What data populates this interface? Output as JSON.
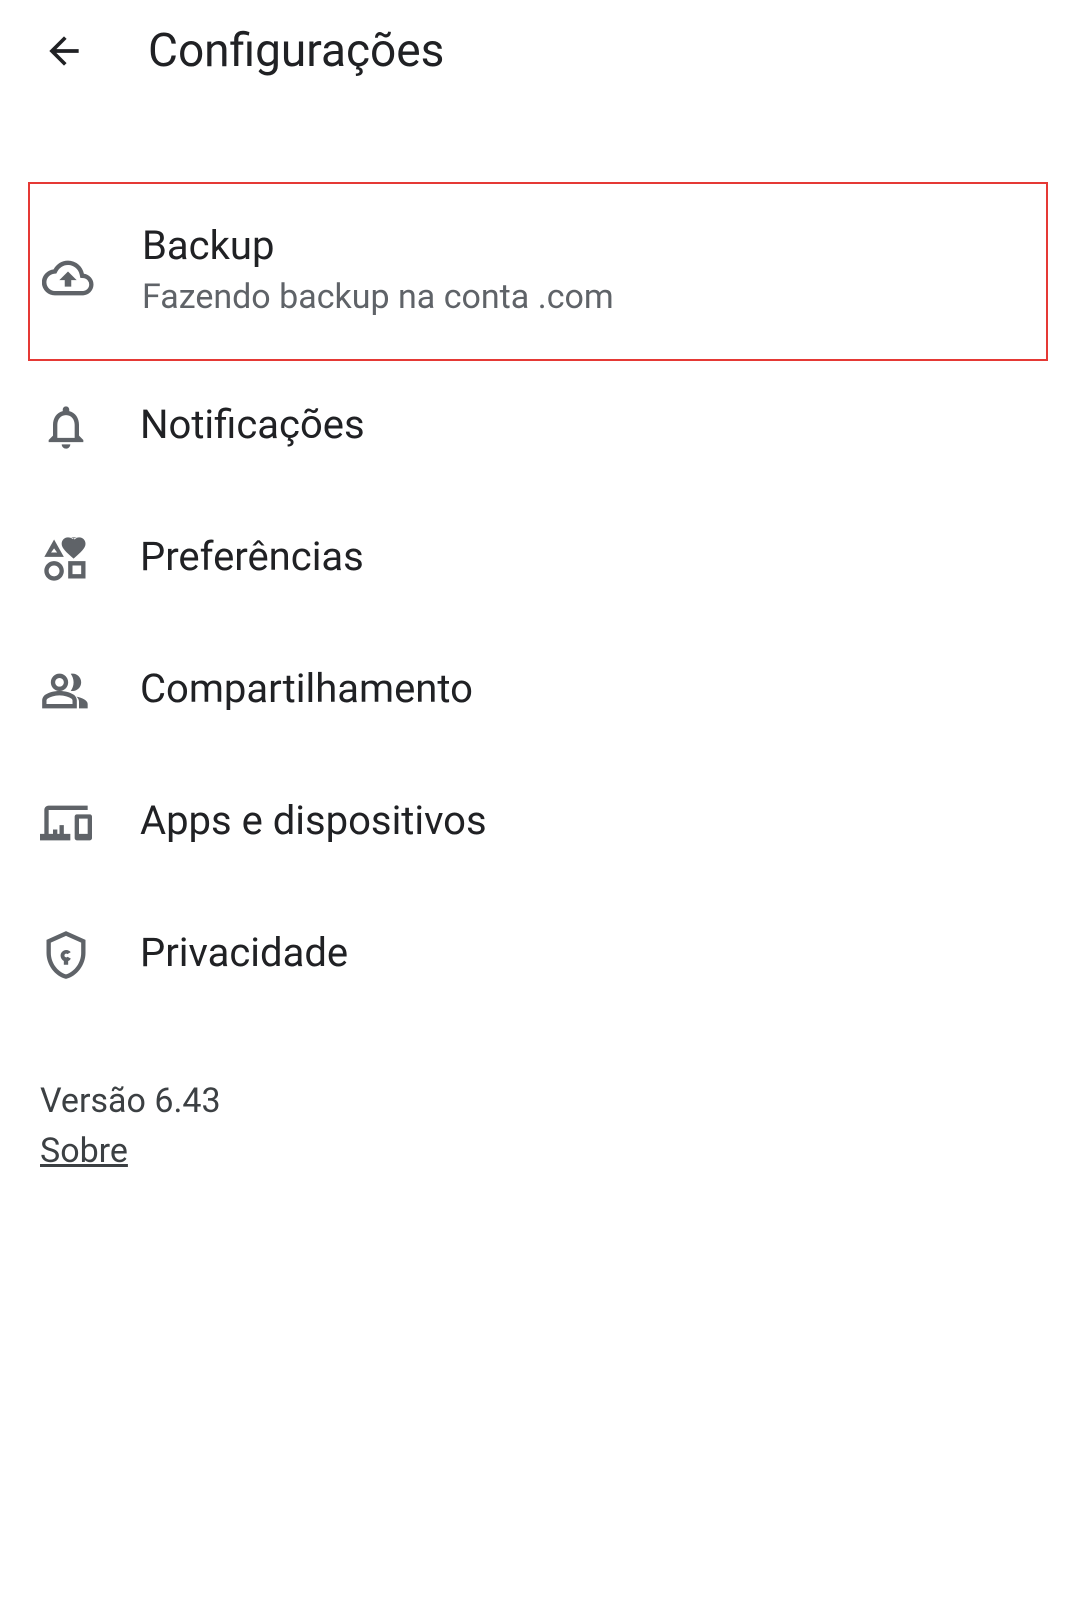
{
  "header": {
    "title": "Configurações"
  },
  "items": {
    "backup": {
      "title": "Backup",
      "subtitle": "Fazendo backup na conta                         .com"
    },
    "notifications": {
      "title": "Notificações"
    },
    "preferences": {
      "title": "Preferências"
    },
    "sharing": {
      "title": "Compartilhamento"
    },
    "apps": {
      "title": "Apps e dispositivos"
    },
    "privacy": {
      "title": "Privacidade"
    }
  },
  "footer": {
    "version": "Versão 6.43",
    "about": "Sobre"
  }
}
